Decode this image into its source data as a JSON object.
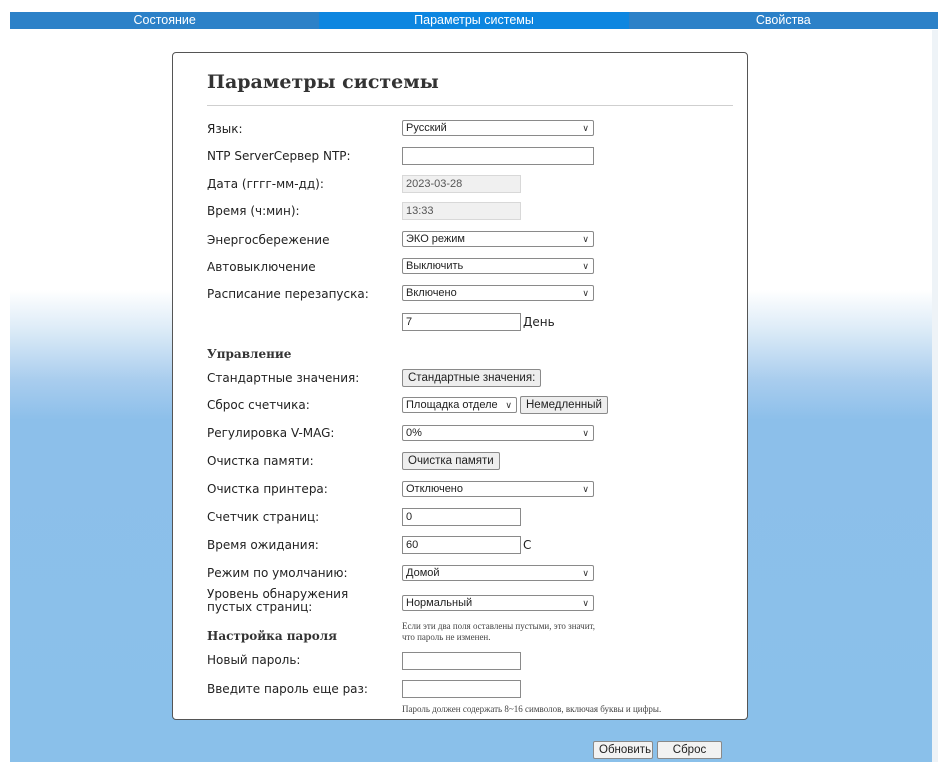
{
  "tabs": {
    "status": "Состояние",
    "system": "Параметры системы",
    "props": "Свойства"
  },
  "title": "Параметры системы",
  "fields": {
    "language_label": "Язык:",
    "language_value": "Русский",
    "ntp_label": "NTP ServerСервер NTP:",
    "ntp_value": "",
    "date_label": "Дата (гггг-мм-дд):",
    "date_value": "2023-03-28",
    "time_label": "Время (ч:мин):",
    "time_value": "13:33",
    "power_label": "Энергосбережение",
    "power_value": "ЭКО режим",
    "autooff_label": "Автовыключение",
    "autooff_value": "Выключить",
    "restart_label": "Расписание перезапуска:",
    "restart_value": "Включено",
    "restart_days_value": "7",
    "restart_days_unit": "День"
  },
  "management": {
    "header": "Управление",
    "defaults_label": "Стандартные значения:",
    "defaults_button": "Стандартные значения:",
    "counter_reset_label": "Сброс счетчика:",
    "counter_reset_value": "Площадка отделе",
    "counter_reset_button": "Немедленный",
    "vmag_label": "Регулировка V-MAG:",
    "vmag_value": "0%",
    "mem_clear_label": "Очистка памяти:",
    "mem_clear_button": "Очистка памяти",
    "printer_clean_label": "Очистка принтера:",
    "printer_clean_value": "Отключено",
    "page_counter_label": "Счетчик страниц:",
    "page_counter_value": "0",
    "timeout_label": "Время ожидания:",
    "timeout_value": "60",
    "timeout_unit": "С",
    "default_mode_label": "Режим по умолчанию:",
    "default_mode_value": "Домой",
    "blank_level_label": "Уровень обнаружения пустых страниц:",
    "blank_level_value": "Нормальный"
  },
  "password": {
    "header": "Настройка пароля",
    "note_top": "Если эти два поля оставлены пустыми, это значит, что пароль не изменен.",
    "new_label": "Новый пароль:",
    "new_value": "",
    "repeat_label": "Введите пароль еще раз:",
    "repeat_value": "",
    "note_bottom": "Пароль должен содержать 8~16 символов, включая буквы и цифры."
  },
  "buttons": {
    "update": "Обновить",
    "reset": "Сброс"
  }
}
